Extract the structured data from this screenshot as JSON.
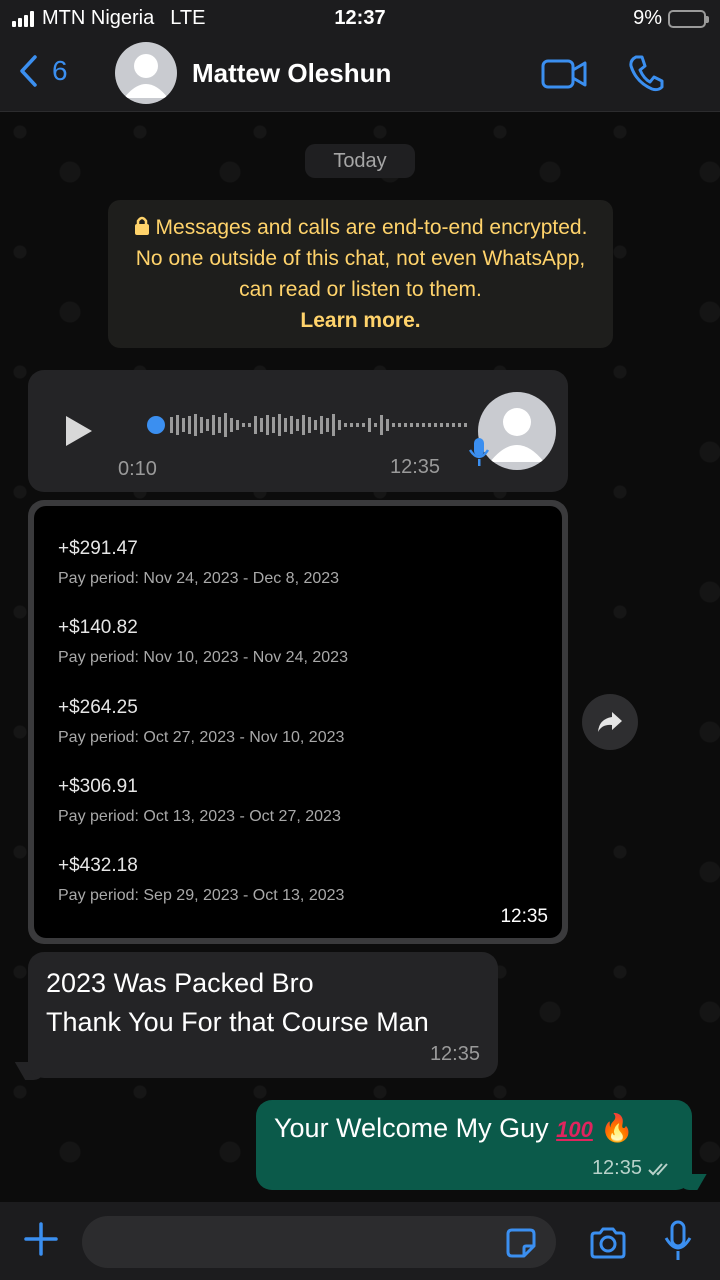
{
  "status_bar": {
    "carrier": "MTN Nigeria",
    "network": "LTE",
    "time": "12:37",
    "battery": "9%",
    "battery_level": 0.09
  },
  "header": {
    "back_count": "6",
    "contact_name": "Mattew Oleshun"
  },
  "chat": {
    "date_label": "Today",
    "encryption_notice": "Messages and calls are end-to-end encrypted. No one outside of this chat, not even WhatsApp, can read or listen to them.",
    "learn_more": "Learn more.",
    "voice_message": {
      "duration": "0:10",
      "time": "12:35"
    },
    "image_message": {
      "time": "12:35",
      "payments": [
        {
          "amount": "+$291.47",
          "period": "Pay period: Nov 24, 2023 - Dec 8, 2023"
        },
        {
          "amount": "+$140.82",
          "period": "Pay period: Nov 10, 2023 - Nov 24, 2023"
        },
        {
          "amount": "+$264.25",
          "period": "Pay period: Oct 27, 2023 - Nov 10, 2023"
        },
        {
          "amount": "+$306.91",
          "period": "Pay period: Oct 13, 2023 - Oct 27, 2023"
        },
        {
          "amount": "+$432.18",
          "period": "Pay period: Sep 29, 2023 - Oct 13, 2023"
        }
      ]
    },
    "incoming_text": {
      "line1": "2023 Was Packed Bro",
      "line2": "Thank You For that Course Man",
      "time": "12:35"
    },
    "outgoing_text": {
      "text": "Your Welcome My Guy",
      "emoji_100": "100",
      "emoji_fire": "🔥",
      "time": "12:35"
    }
  },
  "input": {
    "placeholder": ""
  },
  "colors": {
    "accent": "#3b8ff0",
    "outgoing_bubble": "#0b5a4a",
    "incoming_bubble": "#242426",
    "notice_text": "#ffd36b"
  }
}
